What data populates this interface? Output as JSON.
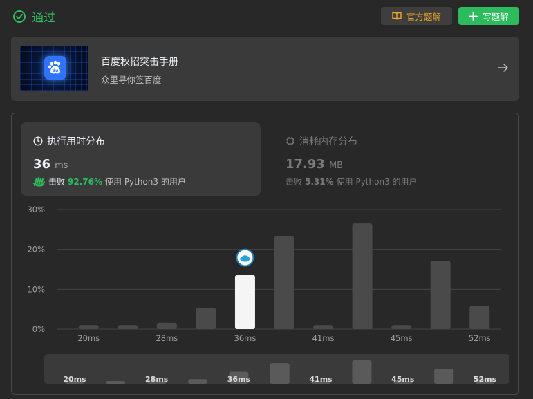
{
  "header": {
    "status": "通过",
    "official_solution": "官方题解",
    "write_solution": "写题解"
  },
  "promo": {
    "title": "百度秋招突击手册",
    "subtitle": "众里寻你签百度"
  },
  "runtime": {
    "title": "执行用时分布",
    "value": "36",
    "unit": "ms",
    "beat_label": "击败",
    "beat_percent": "92.76%",
    "beat_suffix": "使用 Python3 的用户"
  },
  "memory": {
    "title": "消耗内存分布",
    "value": "17.93",
    "unit": "MB",
    "beat_label": "击败",
    "beat_percent": "5.31%",
    "beat_suffix": "使用 Python3 的用户"
  },
  "colors": {
    "accent_green": "#2cbb5d",
    "bar": "#4a4a4a",
    "highlight_bar": "#f5f5f5"
  },
  "chart_data": {
    "type": "bar",
    "bins": [
      "",
      "",
      "",
      "",
      "36ms",
      "",
      "",
      "",
      "",
      "",
      ""
    ],
    "values": [
      1.0,
      1.0,
      1.6,
      5.3,
      13.6,
      23.3,
      1.0,
      26.5,
      1.0,
      17.1,
      5.8
    ],
    "highlight_index": 4,
    "x_tick_labels": [
      "20ms",
      "28ms",
      "36ms",
      "41ms",
      "45ms",
      "52ms"
    ],
    "x_tick_positions": [
      0,
      2,
      4,
      6,
      8,
      10
    ],
    "y_ticks": [
      "0%",
      "10%",
      "20%",
      "30%"
    ],
    "ylim": [
      0,
      30
    ],
    "grid": true
  },
  "mini_chart": {
    "x_tick_labels": [
      "20ms",
      "28ms",
      "36ms",
      "41ms",
      "45ms",
      "52ms"
    ]
  }
}
